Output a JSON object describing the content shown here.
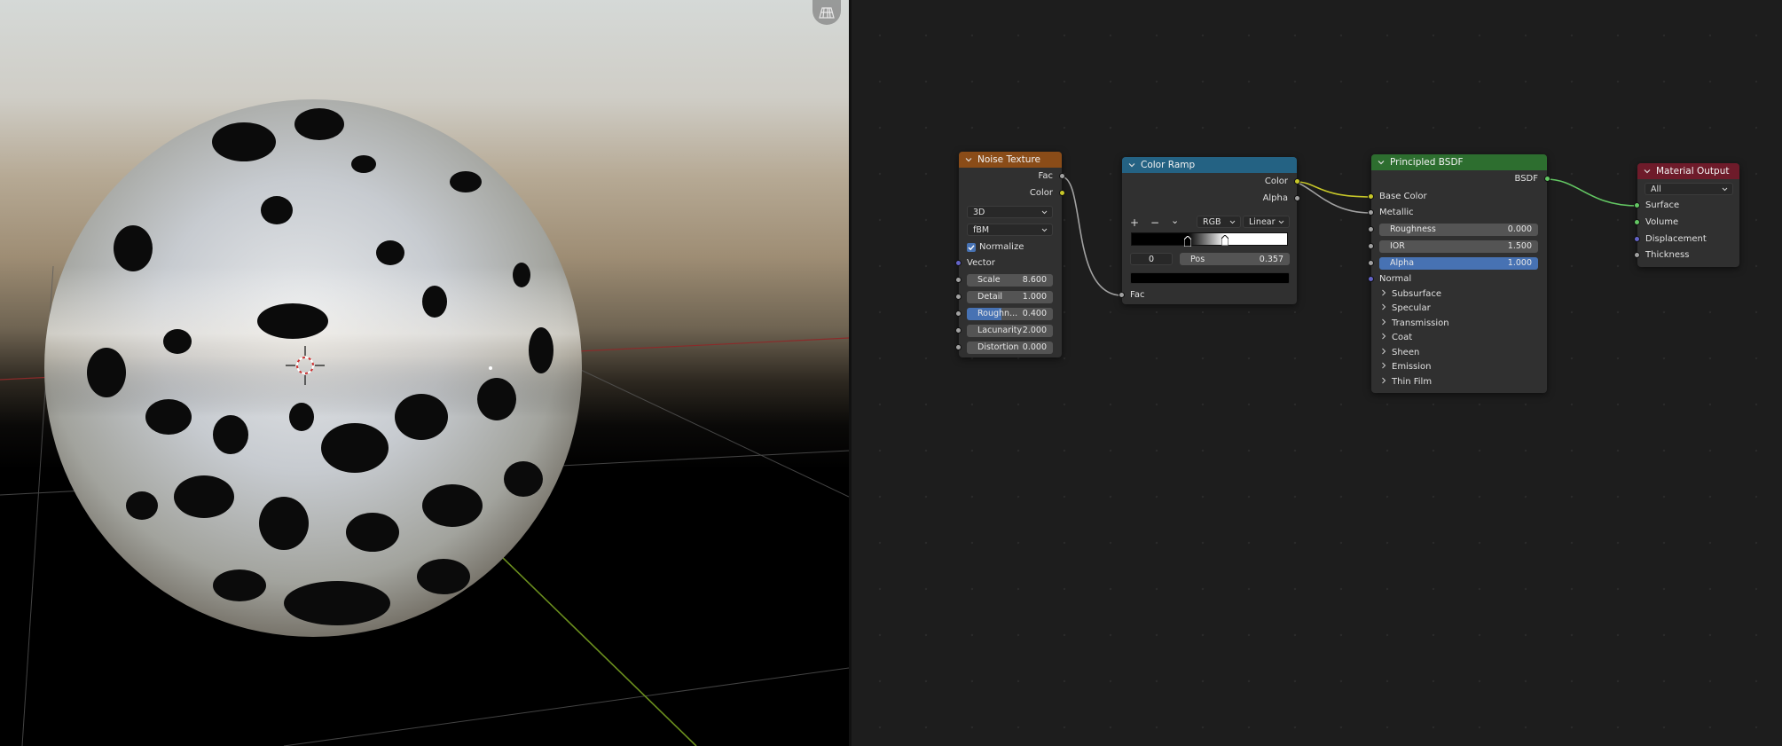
{
  "viewport": {
    "icons": {
      "gizmo": "grid-toggle-icon",
      "cursor": "3d-cursor-icon"
    }
  },
  "noise_texture": {
    "title": "Noise Texture",
    "header_color": "#8a4c18",
    "outputs": {
      "fac": "Fac",
      "color": "Color"
    },
    "dimensions": "3D",
    "type": "fBM",
    "normalize_label": "Normalize",
    "normalize_checked": true,
    "vector_label": "Vector",
    "params": [
      {
        "label": "Scale",
        "value": "8.600",
        "active": false
      },
      {
        "label": "Detail",
        "value": "1.000",
        "active": false
      },
      {
        "label": "Roughn...",
        "value": "0.400",
        "active": true
      },
      {
        "label": "Lacunarity",
        "value": "2.000",
        "active": false
      },
      {
        "label": "Distortion",
        "value": "0.000",
        "active": false
      }
    ]
  },
  "color_ramp": {
    "title": "Color Ramp",
    "header_color": "#246283",
    "outputs": {
      "color": "Color",
      "alpha": "Alpha"
    },
    "add": "+",
    "remove": "−",
    "menu": "⌄",
    "color_mode": "RGB",
    "interpolation": "Linear",
    "stop_index": "0",
    "pos_label": "Pos",
    "pos_value": "0.357",
    "input": "Fac"
  },
  "principled_bsdf": {
    "title": "Principled BSDF",
    "header_color": "#2d6e2f",
    "output": "BSDF",
    "inputs": {
      "base_color": "Base Color",
      "metallic": "Metallic",
      "normal": "Normal"
    },
    "params": [
      {
        "label": "Roughness",
        "value": "0.000",
        "active": false
      },
      {
        "label": "IOR",
        "value": "1.500",
        "active": false
      },
      {
        "label": "Alpha",
        "value": "1.000",
        "active": true
      }
    ],
    "panels": [
      "Subsurface",
      "Specular",
      "Transmission",
      "Coat",
      "Sheen",
      "Emission",
      "Thin Film"
    ]
  },
  "material_output": {
    "title": "Material Output",
    "header_color": "#6e1b2a",
    "target": "All",
    "inputs": [
      "Surface",
      "Volume",
      "Displacement",
      "Thickness"
    ]
  }
}
